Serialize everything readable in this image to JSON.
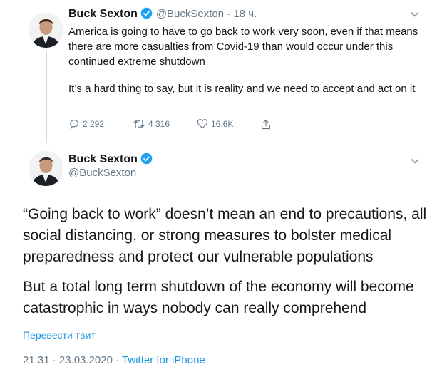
{
  "tweet1": {
    "name": "Buck Sexton",
    "handle": "@BuckSexton",
    "time": "18 ч.",
    "paragraphs": [
      "America is going to have to go back to work very soon, even if that means there are more casualties from Covid-19 than would occur under this continued extreme shutdown",
      "It’s a hard thing to say, but it is reality and we need to accept and act on it"
    ],
    "replies": "2 292",
    "retweets": "4 316",
    "likes": "16,6K"
  },
  "tweet2": {
    "name": "Buck Sexton",
    "handle": "@BuckSexton",
    "paragraphs": [
      "“Going back to work” doesn’t mean an end to precautions, all social distancing, or strong measures to bolster medical preparedness and protect our vulnerable populations",
      "But a total long term shutdown of the economy will become catastrophic in ways nobody can really comprehend"
    ],
    "translate_label": "Перевести твит",
    "timestamp": "21:31 · 23.03.2020",
    "source": "Twitter for iPhone"
  },
  "colors": {
    "accent": "#1b95e0",
    "muted": "#657786",
    "text": "#14171a",
    "verified": "#1da1f2"
  },
  "icons": [
    "verified-badge-icon",
    "chevron-down-icon",
    "reply-icon",
    "retweet-icon",
    "like-icon",
    "share-icon"
  ]
}
